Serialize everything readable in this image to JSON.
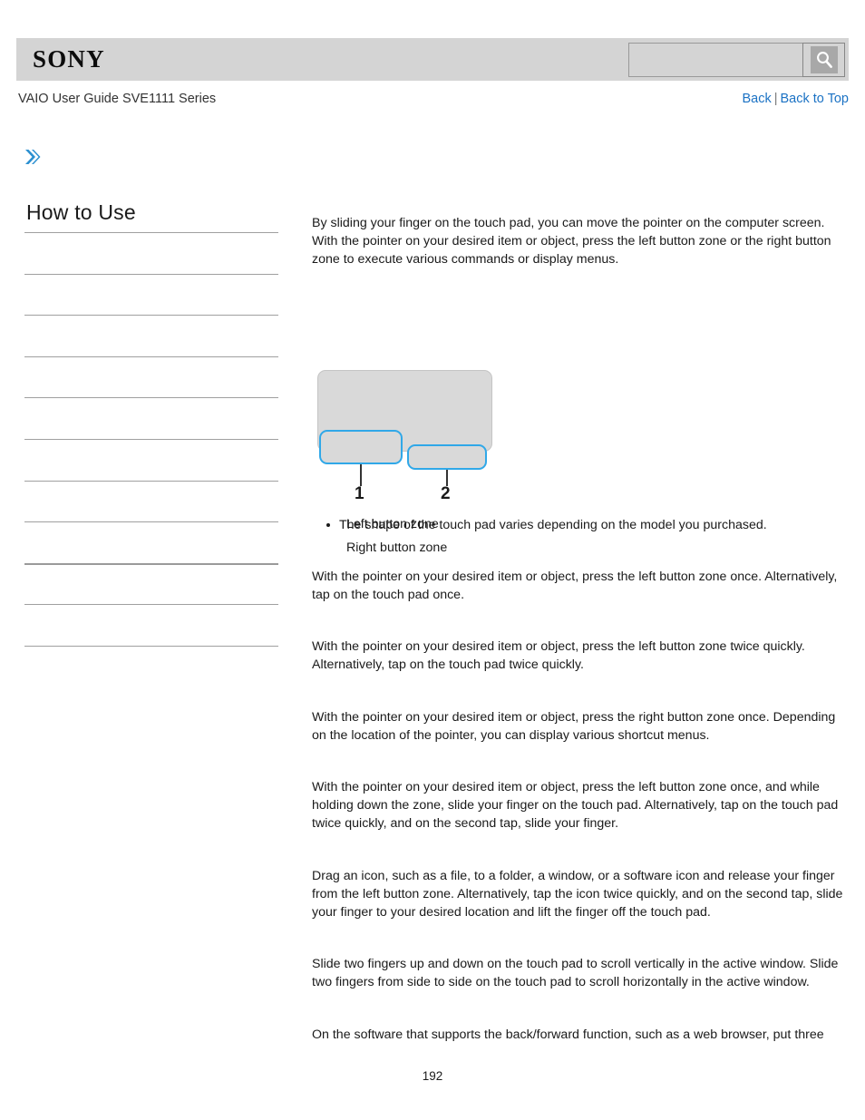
{
  "header": {
    "logo_text": "SONY",
    "search": {
      "value": "",
      "placeholder": "",
      "icon": "search-icon"
    }
  },
  "breadcrumb": {
    "guide_title": "VAIO User Guide SVE1111 Series",
    "back_label": "Back",
    "separator": "|",
    "back_to_top_label": "Back to Top"
  },
  "chevron": {
    "icon": "double-chevron-right-icon",
    "color": "#2a8fd0"
  },
  "sidebar": {
    "title": "How to Use",
    "items": [
      {
        "label": ""
      },
      {
        "label": ""
      },
      {
        "label": ""
      },
      {
        "label": ""
      },
      {
        "label": ""
      },
      {
        "label": ""
      },
      {
        "label": ""
      },
      {
        "label": ""
      },
      {
        "label": ""
      },
      {
        "label": ""
      }
    ]
  },
  "main": {
    "intro": "By sliding your finger on the touch pad, you can move the pointer on the computer screen. With the pointer on your desired item or object, press the left button zone or the right button zone to execute various commands or display menus.",
    "figure": {
      "callout_1": "1",
      "callout_2": "2",
      "legend": [
        "Left button zone",
        "Right button zone"
      ]
    },
    "note": "The shape of the touch pad varies depending on the model you purchased.",
    "sections": [
      "With the pointer on your desired item or object, press the left button zone once. Alternatively, tap on the touch pad once.",
      "With the pointer on your desired item or object, press the left button zone twice quickly. Alternatively, tap on the touch pad twice quickly.",
      "With the pointer on your desired item or object, press the right button zone once. Depending on the location of the pointer, you can display various shortcut menus.",
      "With the pointer on your desired item or object, press the left button zone once, and while holding down the zone, slide your finger on the touch pad. Alternatively, tap on the touch pad twice quickly, and on the second tap, slide your finger.",
      "Drag an icon, such as a file, to a folder, a window, or a software icon and release your finger from the left button zone. Alternatively, tap the icon twice quickly, and on the second tap, slide your finger to your desired location and lift the finger off the touch pad.",
      "Slide two fingers up and down on the touch pad to scroll vertically in the active window. Slide two fingers from side to side on the touch pad to scroll horizontally in the active window.",
      "On the software that supports the back/forward function, such as a web browser, put three"
    ]
  },
  "footer": {
    "page_number": "192"
  },
  "colors": {
    "link": "#1b72c4",
    "accent_blue": "#30a8e8",
    "header_band": "#d4d4d4",
    "touchpad_gray": "#d9d9d9"
  }
}
